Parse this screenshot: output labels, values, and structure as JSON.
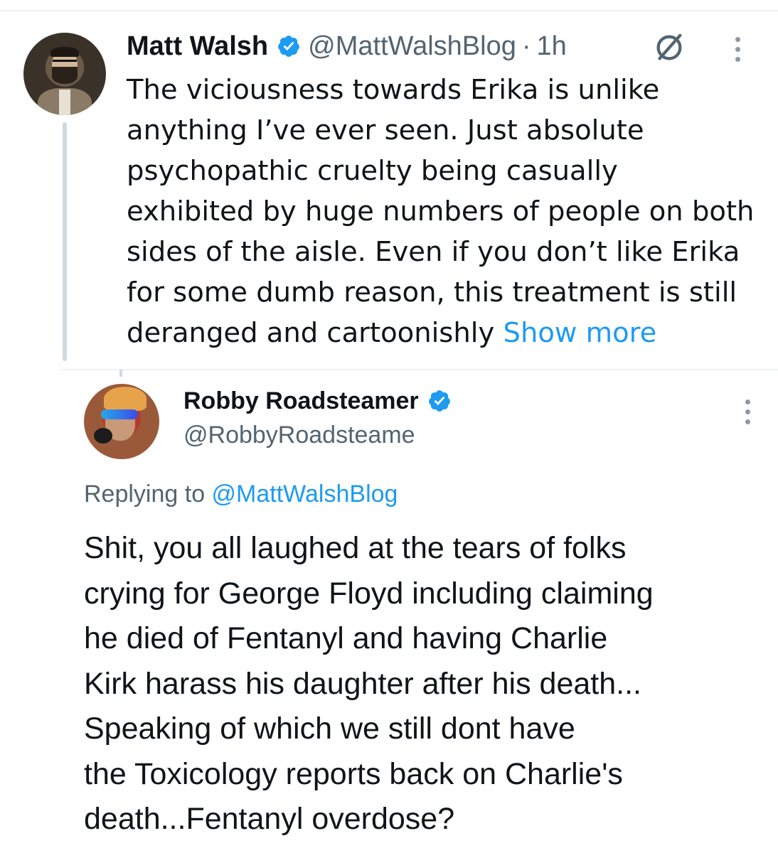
{
  "original_tweet": {
    "author_name": "Matt Walsh",
    "author_handle": "@MattWalshBlog",
    "separator": "·",
    "time": "1h",
    "verified": true,
    "text": "The viciousness towards Erika is unlike\nanything I’ve ever seen. Just absolute\npsychopathic cruelty being casually\nexhibited by huge numbers of people on both\nsides of the aisle. Even if you don’t like Erika\nfor some dumb reason, this treatment is still\nderanged and cartoonishly ",
    "show_more_label": "Show more",
    "icons": [
      "verified-badge-icon",
      "grok-icon",
      "more-options-icon"
    ]
  },
  "reply_tweet": {
    "author_name": "Robby Roadsteamer",
    "author_handle": "@RobbyRoadsteame",
    "verified": true,
    "replying_prefix": "Replying to ",
    "replying_to": "@MattWalshBlog",
    "text": "Shit, you all laughed at the tears of folks\ncrying for George Floyd including claiming\nhe died of Fentanyl and having Charlie\nKirk harass his daughter after his death...\nSpeaking of which we still dont have\nthe Toxicology reports back on Charlie's\ndeath...Fentanyl overdose?",
    "icons": [
      "verified-badge-icon",
      "more-options-icon"
    ]
  },
  "colors": {
    "text_primary": "#0f1419",
    "text_secondary": "#536471",
    "link": "#1d9bf0",
    "verified": "#1d9bf0",
    "divider": "#eef1f3"
  }
}
